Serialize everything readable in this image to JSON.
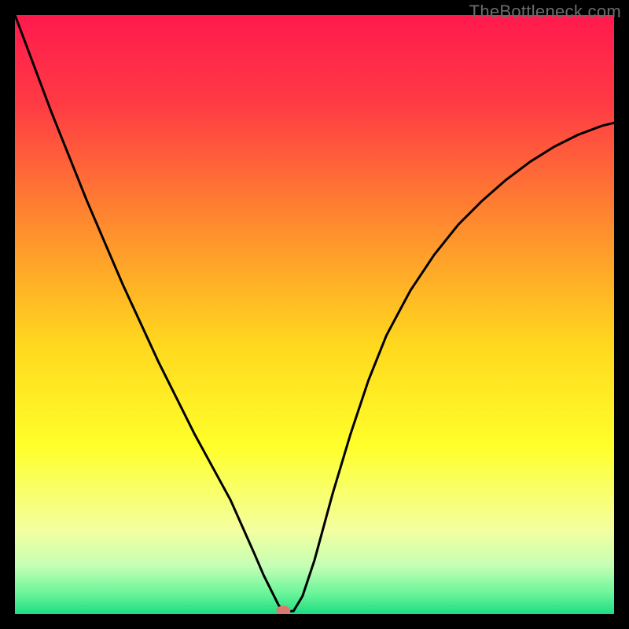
{
  "watermark": "TheBottleneck.com",
  "chart_data": {
    "type": "line",
    "title": "",
    "xlabel": "",
    "ylabel": "",
    "xlim": [
      0,
      100
    ],
    "ylim": [
      0,
      100
    ],
    "background_gradient": {
      "stops": [
        {
          "offset": 0.0,
          "color": "#ff1a4d"
        },
        {
          "offset": 0.15,
          "color": "#ff3b44"
        },
        {
          "offset": 0.35,
          "color": "#ff8b2e"
        },
        {
          "offset": 0.55,
          "color": "#ffd81e"
        },
        {
          "offset": 0.72,
          "color": "#ffff2a"
        },
        {
          "offset": 0.86,
          "color": "#f3ffa0"
        },
        {
          "offset": 0.92,
          "color": "#c4ffb4"
        },
        {
          "offset": 0.965,
          "color": "#6bf59a"
        },
        {
          "offset": 1.0,
          "color": "#1fdc82"
        }
      ]
    },
    "series": [
      {
        "name": "bottleneck-curve",
        "x": [
          0,
          3,
          6,
          9,
          12,
          15,
          18,
          21,
          24,
          27,
          30,
          33,
          36,
          38,
          40,
          41.5,
          43,
          44,
          44.8,
          46.5,
          48,
          50,
          53,
          56,
          59,
          62,
          66,
          70,
          74,
          78,
          82,
          86,
          90,
          94,
          98,
          100
        ],
        "y": [
          100,
          92,
          84,
          76.5,
          69,
          62,
          55,
          48.5,
          42,
          36,
          30,
          24.5,
          19,
          14.5,
          10,
          6.5,
          3.5,
          1.5,
          0.5,
          0.5,
          3,
          9,
          20,
          30,
          39,
          46.5,
          54,
          60,
          65,
          69,
          72.5,
          75.5,
          78,
          80,
          81.5,
          82
        ]
      }
    ],
    "marker": {
      "x": 44.8,
      "y": 0.6,
      "color": "#d97a6d",
      "rx": 9,
      "ry": 6
    }
  }
}
